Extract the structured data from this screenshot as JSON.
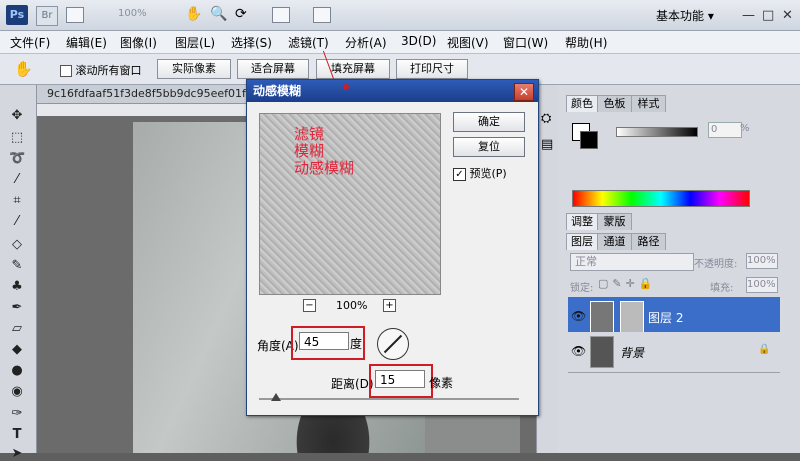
{
  "titlebar": {
    "ps_logo": "Ps",
    "br_logo": "Br",
    "zoom": "100%",
    "workspace": "基本功能",
    "workspace_arrow": "▾",
    "min": "—",
    "max": "□",
    "close": "✕"
  },
  "menu": [
    "文件(F)",
    "编辑(E)",
    "图像(I)",
    "图层(L)",
    "选择(S)",
    "滤镜(T)",
    "分析(A)",
    "3D(D)",
    "视图(V)",
    "窗口(W)",
    "帮助(H)"
  ],
  "options": {
    "scroll_all": "滚动所有窗口",
    "actual_pixels": "实际像素",
    "fit_screen": "适合屏幕",
    "fill_screen": "填充屏幕",
    "print_size": "打印尺寸"
  },
  "document": {
    "tab_title": "9c16fdfaaf51f3de8f5bb9dc95eef01f3fb298"
  },
  "dialog": {
    "title": "动感模糊",
    "ok": "确定",
    "reset": "复位",
    "preview_label": "预览(P)",
    "preview_checked": "✓",
    "zoom_out": "−",
    "zoom_in": "+",
    "zoom_value": "100%",
    "angle_label": "角度(A):",
    "angle_value": "45",
    "angle_unit": "度",
    "distance_label": "距离(D):",
    "distance_value": "15",
    "distance_unit": "像素",
    "annotation_lines": [
      "滤镜",
      "模糊",
      "动感模糊"
    ]
  },
  "panels": {
    "color_tabs": [
      "颜色",
      "色板",
      "样式"
    ],
    "color_value": "0",
    "color_unit": "%",
    "adjust_tabs": [
      "调整",
      "蒙版"
    ],
    "layer_tabs": [
      "图层",
      "通道",
      "路径"
    ],
    "blend_mode": "正常",
    "opacity_label": "不透明度:",
    "opacity_value": "100%",
    "lock_label": "锁定:",
    "fill_label": "填充:",
    "fill_value": "100%",
    "layers": [
      {
        "name": "图层 2",
        "selected": true
      },
      {
        "name": "背景",
        "selected": false
      }
    ]
  },
  "colors": {
    "dialog_title_bg": "#1b3e8a",
    "annotation_red": "#e0263a",
    "selected_layer": "#3b6ec8"
  }
}
